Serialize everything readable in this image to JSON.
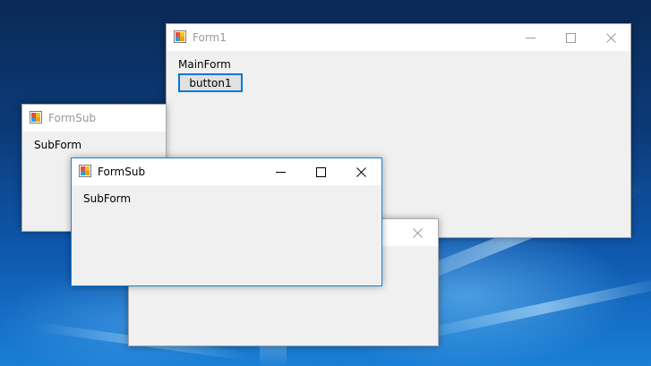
{
  "windows": {
    "form1": {
      "title": "Form1",
      "label": "MainForm",
      "button_label": "button1"
    },
    "formsub_back": {
      "title": "FormSub",
      "label": "SubForm"
    },
    "formsub_front": {
      "title": "FormSub",
      "label": "SubForm"
    },
    "hidden_window": {
      "title": ""
    }
  },
  "icons": {
    "app": "form-app-icon",
    "minimize": "minimize-icon",
    "maximize": "maximize-icon",
    "close": "close-icon"
  },
  "colors": {
    "active_border": "#1883d7",
    "client_bg": "#f0f0f0",
    "titlebar_bg": "#ffffff",
    "inactive_title": "#999999",
    "button_focus": "#0078d7"
  }
}
